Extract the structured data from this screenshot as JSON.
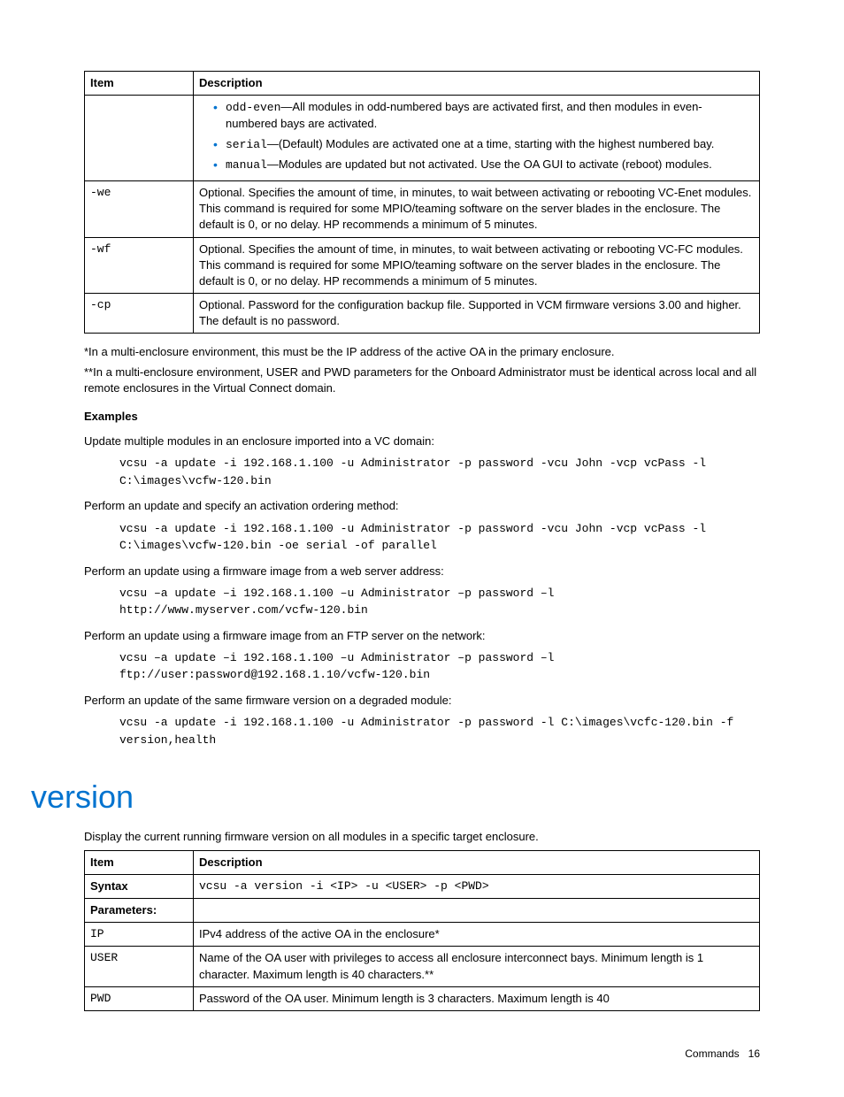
{
  "table1": {
    "headers": {
      "item": "Item",
      "desc": "Description"
    },
    "rows": [
      {
        "item": "",
        "bullets": [
          {
            "code": "odd-even",
            "text": "—All modules in odd-numbered bays are activated first, and then modules in even-numbered bays are activated."
          },
          {
            "code": "serial",
            "text": "—(Default) Modules are activated one at a time, starting with the highest numbered bay."
          },
          {
            "code": "manual",
            "text": "—Modules are updated but not activated. Use the OA GUI to activate (reboot) modules."
          }
        ]
      },
      {
        "item": "-we",
        "desc": "Optional. Specifies the amount of time, in minutes, to wait between activating or rebooting VC-Enet modules. This command is required for some MPIO/teaming software on the server blades in the enclosure. The default is 0, or no delay. HP recommends a minimum of 5 minutes."
      },
      {
        "item": "-wf",
        "desc": "Optional. Specifies the amount of time, in minutes, to wait between activating or rebooting VC-FC modules. This command is required for some MPIO/teaming software on the server blades in the enclosure. The default is 0, or no delay. HP recommends a minimum of 5 minutes."
      },
      {
        "item": "-cp",
        "desc": "Optional. Password for the configuration backup file. Supported in VCM firmware versions 3.00 and higher. The default is no password."
      }
    ]
  },
  "notes": {
    "n1": "*In a multi-enclosure environment, this must be the IP address of the active OA in the primary enclosure.",
    "n2": "**In a multi-enclosure environment, USER and PWD parameters for the Onboard Administrator must be identical across local and all remote enclosures in the Virtual Connect domain."
  },
  "examples": {
    "heading": "Examples",
    "items": [
      {
        "intro": "Update multiple modules in an enclosure imported into a VC domain:",
        "code": "vcsu -a update -i 192.168.1.100 -u Administrator -p password -vcu John -vcp vcPass -l C:\\images\\vcfw-120.bin"
      },
      {
        "intro": "Perform an update and specify an activation ordering method:",
        "code": "vcsu -a update -i 192.168.1.100 -u Administrator -p password -vcu John -vcp vcPass -l C:\\images\\vcfw-120.bin -oe serial -of parallel"
      },
      {
        "intro": "Perform an update using a firmware image from a web server address:",
        "code": "vcsu –a update –i 192.168.1.100 –u Administrator –p password –l http://www.myserver.com/vcfw-120.bin"
      },
      {
        "intro": "Perform an update using a firmware image from an FTP server on the network:",
        "code": "vcsu –a update –i 192.168.1.100 –u Administrator –p password –l ftp://user:password@192.168.1.10/vcfw-120.bin"
      },
      {
        "intro": "Perform an update of the same firmware version on a degraded module:",
        "code": "vcsu -a update -i 192.168.1.100 -u Administrator -p password -l C:\\images\\vcfc-120.bin -f version,health"
      }
    ]
  },
  "version": {
    "heading": "version",
    "intro": "Display the current running firmware version on all modules in a specific target enclosure.",
    "table": {
      "headers": {
        "item": "Item",
        "desc": "Description"
      },
      "rows": [
        {
          "item": "Syntax",
          "mono": true,
          "desc": "vcsu -a version -i <IP> -u <USER> -p <PWD>"
        },
        {
          "item": "Parameters:",
          "desc": ""
        },
        {
          "item": "IP",
          "itemMono": true,
          "desc": "IPv4 address of the active OA in the enclosure*"
        },
        {
          "item": "USER",
          "itemMono": true,
          "desc": "Name of the OA user with privileges to access all enclosure interconnect bays. Minimum length is 1 character. Maximum length is 40 characters.**"
        },
        {
          "item": "PWD",
          "itemMono": true,
          "desc": "Password of the OA user. Minimum length is 3 characters. Maximum length is 40"
        }
      ]
    }
  },
  "footer": {
    "label": "Commands",
    "page": "16"
  }
}
